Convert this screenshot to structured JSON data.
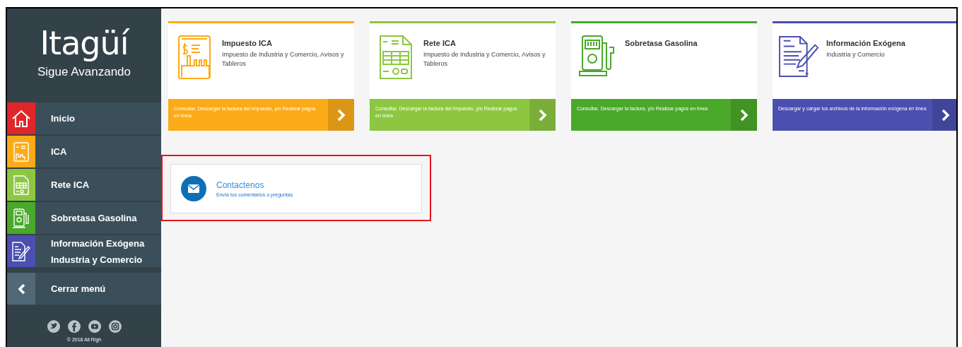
{
  "sidebar": {
    "logo": {
      "title": "Itagüí",
      "subtitle": "Sigue Avanzando"
    },
    "items": [
      {
        "label": "Inicio",
        "kind": "house",
        "color": "#e0262b"
      },
      {
        "label": "ICA",
        "kind": "invoice",
        "color": "#fbab18"
      },
      {
        "label": "Rete ICA",
        "kind": "table",
        "color": "#8dc741"
      },
      {
        "label": "Sobretasa Gasolina",
        "kind": "pump",
        "color": "#4aa82a"
      },
      {
        "label": "Información Exógena",
        "sublabel": "Industria y Comercio",
        "kind": "document",
        "color": "#4a4fb0"
      },
      {
        "label": "Cerrar menú",
        "kind": "chevron",
        "color": "#516977"
      }
    ],
    "social": [
      {
        "kind": "twitter"
      },
      {
        "kind": "facebook"
      },
      {
        "kind": "youtube"
      },
      {
        "kind": "instagram"
      }
    ],
    "copyright": "© 2018 All Righ"
  },
  "cards": [
    {
      "title": "Impuesto ICA",
      "description": "Impuesto de Industria y Comercio, Avisos y Tableros",
      "action": "Consultar, Descargar la factura del Impuesto, y/o Realizar pagos en línea",
      "kind": "invoice",
      "color": "#fbab18"
    },
    {
      "title": "Rete ICA",
      "description": "Impuesto de Industria y Comercio, Avisos y Tableros",
      "action": "Consultar, Descargar la factura del Impuesto, y/o Realizar pagos en línea",
      "kind": "table",
      "color": "#8dc741"
    },
    {
      "title": "Sobretasa Gasolina",
      "action": "Consultar, Descargar la factura, y/o Realizar pagos en línea",
      "kind": "pump",
      "color": "#4aa82a"
    },
    {
      "title": "Información Exógena",
      "description": "Industria y Comercio",
      "action": "Descargar y cargar los archivos de la información exógena en línea",
      "kind": "document",
      "color": "#4a4fb0"
    }
  ],
  "contact": {
    "title": "Contactenos",
    "description": "Envía tus comentarios o preguntas",
    "highlighted": true
  }
}
